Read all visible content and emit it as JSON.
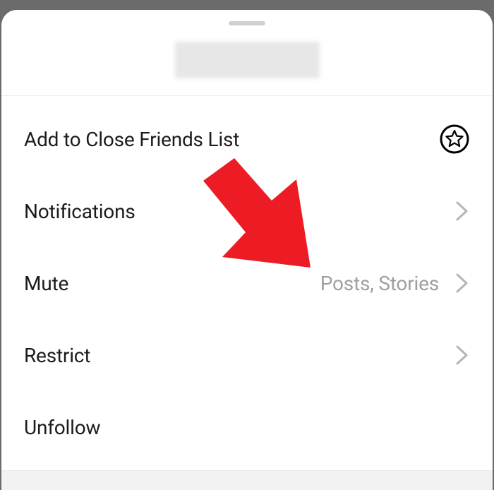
{
  "menu": {
    "close_friends": {
      "label": "Add to Close Friends List"
    },
    "notifications": {
      "label": "Notifications"
    },
    "mute": {
      "label": "Mute",
      "value": "Posts, Stories"
    },
    "restrict": {
      "label": "Restrict"
    },
    "unfollow": {
      "label": "Unfollow"
    }
  },
  "colors": {
    "accent_arrow": "#ed1c24"
  }
}
